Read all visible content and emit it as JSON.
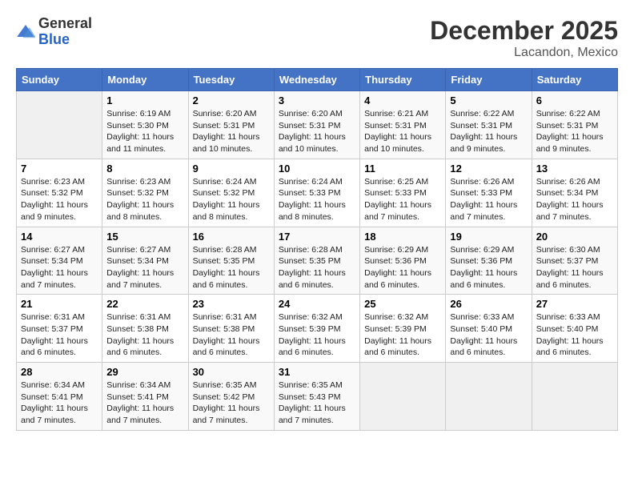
{
  "header": {
    "logo": {
      "general": "General",
      "blue": "Blue"
    },
    "title": "December 2025",
    "location": "Lacandon, Mexico"
  },
  "weekdays": [
    "Sunday",
    "Monday",
    "Tuesday",
    "Wednesday",
    "Thursday",
    "Friday",
    "Saturday"
  ],
  "weeks": [
    [
      {
        "day": "",
        "sunrise": "",
        "sunset": "",
        "daylight": ""
      },
      {
        "day": "1",
        "sunrise": "6:19 AM",
        "sunset": "5:30 PM",
        "daylight": "11 hours and 11 minutes."
      },
      {
        "day": "2",
        "sunrise": "6:20 AM",
        "sunset": "5:31 PM",
        "daylight": "11 hours and 10 minutes."
      },
      {
        "day": "3",
        "sunrise": "6:20 AM",
        "sunset": "5:31 PM",
        "daylight": "11 hours and 10 minutes."
      },
      {
        "day": "4",
        "sunrise": "6:21 AM",
        "sunset": "5:31 PM",
        "daylight": "11 hours and 10 minutes."
      },
      {
        "day": "5",
        "sunrise": "6:22 AM",
        "sunset": "5:31 PM",
        "daylight": "11 hours and 9 minutes."
      },
      {
        "day": "6",
        "sunrise": "6:22 AM",
        "sunset": "5:31 PM",
        "daylight": "11 hours and 9 minutes."
      }
    ],
    [
      {
        "day": "7",
        "sunrise": "6:23 AM",
        "sunset": "5:32 PM",
        "daylight": "11 hours and 9 minutes."
      },
      {
        "day": "8",
        "sunrise": "6:23 AM",
        "sunset": "5:32 PM",
        "daylight": "11 hours and 8 minutes."
      },
      {
        "day": "9",
        "sunrise": "6:24 AM",
        "sunset": "5:32 PM",
        "daylight": "11 hours and 8 minutes."
      },
      {
        "day": "10",
        "sunrise": "6:24 AM",
        "sunset": "5:33 PM",
        "daylight": "11 hours and 8 minutes."
      },
      {
        "day": "11",
        "sunrise": "6:25 AM",
        "sunset": "5:33 PM",
        "daylight": "11 hours and 7 minutes."
      },
      {
        "day": "12",
        "sunrise": "6:26 AM",
        "sunset": "5:33 PM",
        "daylight": "11 hours and 7 minutes."
      },
      {
        "day": "13",
        "sunrise": "6:26 AM",
        "sunset": "5:34 PM",
        "daylight": "11 hours and 7 minutes."
      }
    ],
    [
      {
        "day": "14",
        "sunrise": "6:27 AM",
        "sunset": "5:34 PM",
        "daylight": "11 hours and 7 minutes."
      },
      {
        "day": "15",
        "sunrise": "6:27 AM",
        "sunset": "5:34 PM",
        "daylight": "11 hours and 7 minutes."
      },
      {
        "day": "16",
        "sunrise": "6:28 AM",
        "sunset": "5:35 PM",
        "daylight": "11 hours and 6 minutes."
      },
      {
        "day": "17",
        "sunrise": "6:28 AM",
        "sunset": "5:35 PM",
        "daylight": "11 hours and 6 minutes."
      },
      {
        "day": "18",
        "sunrise": "6:29 AM",
        "sunset": "5:36 PM",
        "daylight": "11 hours and 6 minutes."
      },
      {
        "day": "19",
        "sunrise": "6:29 AM",
        "sunset": "5:36 PM",
        "daylight": "11 hours and 6 minutes."
      },
      {
        "day": "20",
        "sunrise": "6:30 AM",
        "sunset": "5:37 PM",
        "daylight": "11 hours and 6 minutes."
      }
    ],
    [
      {
        "day": "21",
        "sunrise": "6:31 AM",
        "sunset": "5:37 PM",
        "daylight": "11 hours and 6 minutes."
      },
      {
        "day": "22",
        "sunrise": "6:31 AM",
        "sunset": "5:38 PM",
        "daylight": "11 hours and 6 minutes."
      },
      {
        "day": "23",
        "sunrise": "6:31 AM",
        "sunset": "5:38 PM",
        "daylight": "11 hours and 6 minutes."
      },
      {
        "day": "24",
        "sunrise": "6:32 AM",
        "sunset": "5:39 PM",
        "daylight": "11 hours and 6 minutes."
      },
      {
        "day": "25",
        "sunrise": "6:32 AM",
        "sunset": "5:39 PM",
        "daylight": "11 hours and 6 minutes."
      },
      {
        "day": "26",
        "sunrise": "6:33 AM",
        "sunset": "5:40 PM",
        "daylight": "11 hours and 6 minutes."
      },
      {
        "day": "27",
        "sunrise": "6:33 AM",
        "sunset": "5:40 PM",
        "daylight": "11 hours and 6 minutes."
      }
    ],
    [
      {
        "day": "28",
        "sunrise": "6:34 AM",
        "sunset": "5:41 PM",
        "daylight": "11 hours and 7 minutes."
      },
      {
        "day": "29",
        "sunrise": "6:34 AM",
        "sunset": "5:41 PM",
        "daylight": "11 hours and 7 minutes."
      },
      {
        "day": "30",
        "sunrise": "6:35 AM",
        "sunset": "5:42 PM",
        "daylight": "11 hours and 7 minutes."
      },
      {
        "day": "31",
        "sunrise": "6:35 AM",
        "sunset": "5:43 PM",
        "daylight": "11 hours and 7 minutes."
      },
      {
        "day": "",
        "sunrise": "",
        "sunset": "",
        "daylight": ""
      },
      {
        "day": "",
        "sunrise": "",
        "sunset": "",
        "daylight": ""
      },
      {
        "day": "",
        "sunrise": "",
        "sunset": "",
        "daylight": ""
      }
    ]
  ],
  "labels": {
    "sunrise": "Sunrise:",
    "sunset": "Sunset:",
    "daylight": "Daylight:"
  }
}
